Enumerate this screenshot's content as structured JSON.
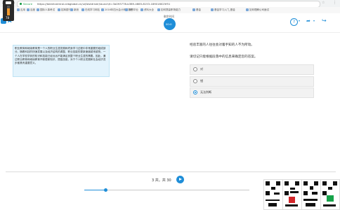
{
  "browser": {
    "secure_label": "Secure",
    "url": "https://talentcentral.cebglobal.cn/ui/testdriver/launch/t=3a093778-b389-4665-8153-189018025f51",
    "bookmarks": [
      "应用",
      "百度",
      "国际人事考试",
      "招商银行",
      "新浪",
      "在线学习网站",
      "2016年四大会计师事务所",
      "我的毕业",
      "资料大全",
      "如何提高职场能力",
      "基金",
      "基金学习入门_基金",
      "如何理解公司面试"
    ]
  },
  "volume": {
    "level": 0.7,
    "value_text": "78"
  },
  "header": {
    "logo_text": "A",
    "timer_label": "剩余时间",
    "timer_value": "00:0",
    "help_icon": "help-circle-icon",
    "mute_icon": "volume-mute-icon",
    "exit_icon": "exit-icon"
  },
  "passage": {
    "text": "职业教育和继续教育是一个人的职业生涯发展和终身学习过程中非常重要的组成部分。随着科技的快速发展以及经济结构的调整，职业技能的更新速度越来越快，一个人在学校学到的知识和技能已经远远不能满足其整个职业生涯的需要。因此，通过职业教育和继续教育不断更新知识、提高技能，对于个人职业发展和社会经济进步都具有重要意义。"
  },
  "question": {
    "statement": "经验丰富的人往往会对着手知的人不为所动。",
    "instruction": "请切记只能根据段落中的信息来确定您的答案。",
    "options": [
      {
        "label": "对",
        "selected": false
      },
      {
        "label": "错",
        "selected": false
      },
      {
        "label": "无法判断",
        "selected": true
      }
    ]
  },
  "pager": {
    "text": "3 共，共 30",
    "next_icon": "play-icon"
  },
  "progress": {
    "fraction": 0.13
  },
  "colors": {
    "accent": "#1f8ed8",
    "passage_bg": "#e3f3fc",
    "selected": "#1f8ed8"
  }
}
